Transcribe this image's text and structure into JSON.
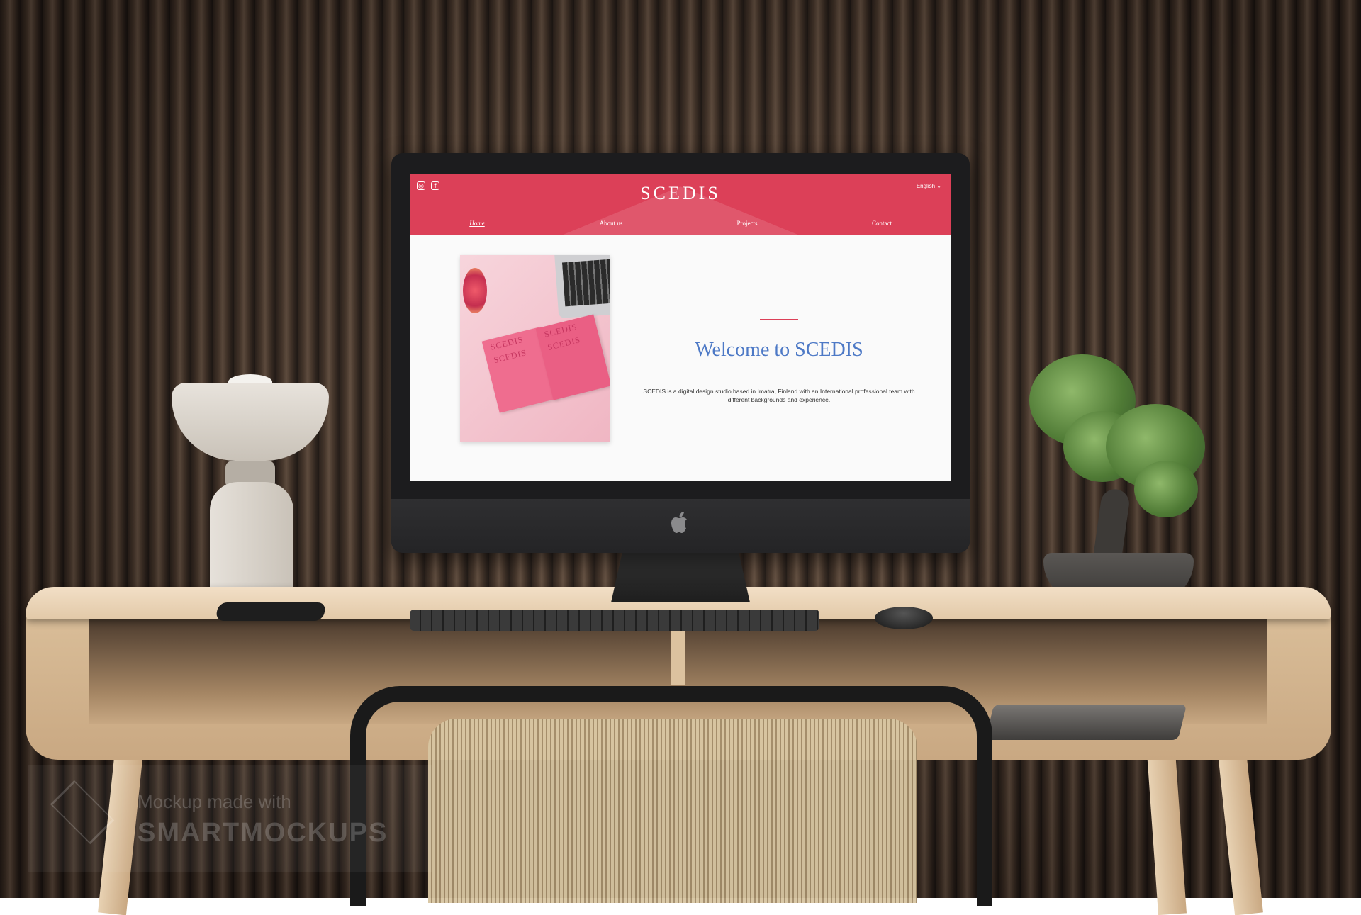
{
  "website": {
    "brand": "SCEDIS",
    "language": "English",
    "language_chevron": "⌄",
    "social": [
      "instagram-icon",
      "facebook-icon"
    ],
    "nav": [
      "Home",
      "About us",
      "Projects",
      "Contact"
    ],
    "active_nav": "Home",
    "hero_book_words": [
      "SCEDIS",
      "SCEDIS",
      "SCEDIS",
      "SCEDIS"
    ],
    "welcome_title": "Welcome to SCEDIS",
    "intro_text": "SCEDIS is a digital design studio based in Imatra, Finland with an International professional team with different backgrounds and experience."
  },
  "watermark": {
    "line1": "Mockup made with",
    "line2": "SMARTMOCKUPS"
  },
  "colors": {
    "header": "#dc4058",
    "title": "#4d79c6",
    "accent": "#dc4058"
  }
}
